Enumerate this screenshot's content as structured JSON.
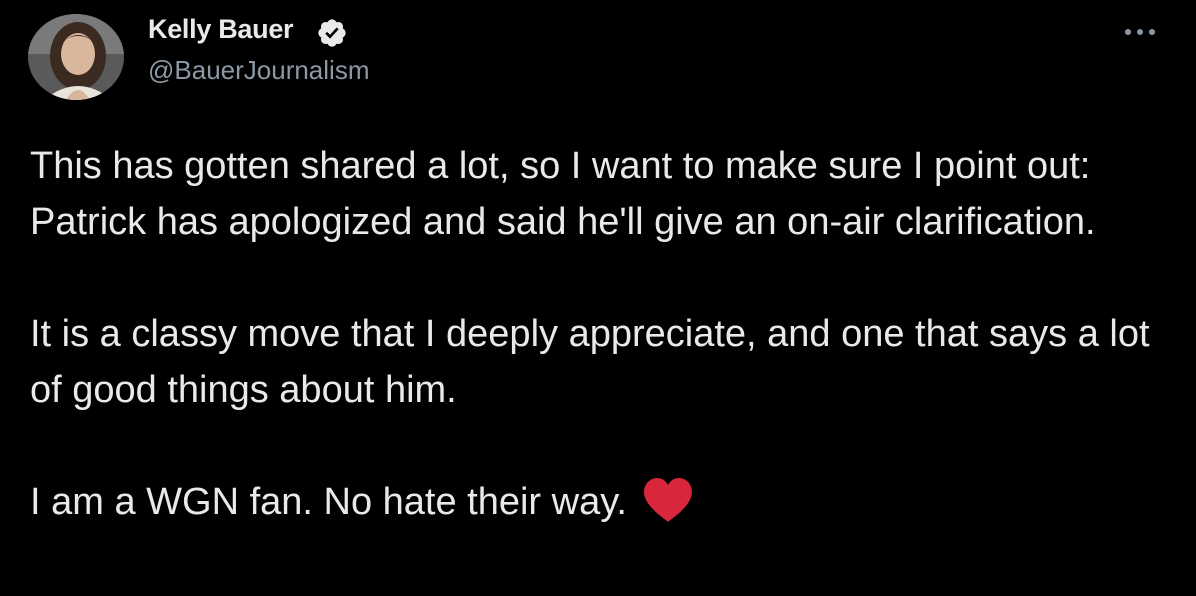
{
  "author": {
    "name": "Kelly Bauer",
    "handle": "@BauerJournalism",
    "verified": true,
    "avatar_icon": "profile-photo"
  },
  "menu": {
    "icon": "more-horizontal-icon"
  },
  "tweet": {
    "paragraphs": [
      "This has gotten shared a lot, so I want to make sure I point out: Patrick has apologized and said he'll give an on-air clarification.",
      "It is a classy move that I deeply appreciate, and one that says a lot of good things about him.",
      "I am a WGN fan. No hate their way."
    ],
    "trailing_emoji": "red-heart-icon"
  },
  "colors": {
    "background": "#000000",
    "text_primary": "#e7e9ea",
    "text_secondary": "#8b98a5",
    "heart": "#d8263c"
  }
}
